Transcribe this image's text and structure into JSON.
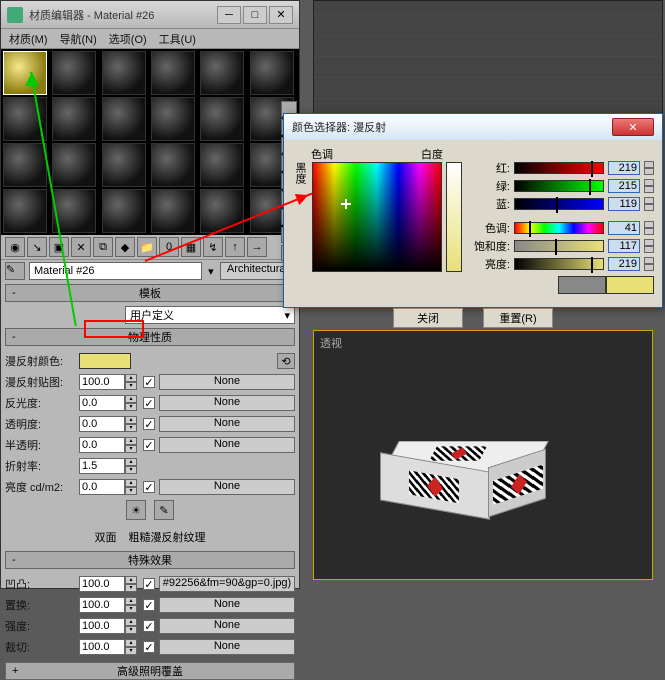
{
  "matEditor": {
    "title": "材质编辑器 - Material #26",
    "menu": [
      "材质(M)",
      "导航(N)",
      "选项(O)",
      "工具(U)"
    ],
    "materialName": "Material #26",
    "materialType": "Architectural"
  },
  "rollouts": {
    "template": {
      "title": "模板",
      "dropdown": "用户定义"
    },
    "physical": {
      "title": "物理性质",
      "diffuseColorLabel": "漫反射颜色:",
      "diffuseColor": "#e8e077",
      "rows": [
        {
          "label": "漫反射贴图:",
          "value": "100.0",
          "check": true,
          "map": "None"
        },
        {
          "label": "反光度:",
          "value": "0.0",
          "check": true,
          "map": "None"
        },
        {
          "label": "透明度:",
          "value": "0.0",
          "check": true,
          "map": "None"
        },
        {
          "label": "半透明:",
          "value": "0.0",
          "check": true,
          "map": "None"
        },
        {
          "label": "折射率:",
          "value": "1.5",
          "check": false,
          "map": ""
        },
        {
          "label": "亮度 cd/m2:",
          "value": "0.0",
          "check": true,
          "map": "None"
        }
      ],
      "twoSided": "双面",
      "roughDiffuse": "粗糙漫反射纹理"
    },
    "special": {
      "title": "特殊效果",
      "rows": [
        {
          "label": "凹凸:",
          "value": "100.0",
          "check": true,
          "map": "#92256&fm=90&gp=0.jpg)"
        },
        {
          "label": "置换:",
          "value": "100.0",
          "check": true,
          "map": "None"
        },
        {
          "label": "强度:",
          "value": "100.0",
          "check": true,
          "map": "None"
        },
        {
          "label": "裁切:",
          "value": "100.0",
          "check": true,
          "map": "None"
        }
      ]
    },
    "advanced": {
      "title": "高级照明覆盖"
    }
  },
  "colorPicker": {
    "title": "颜色选择器: 漫反射",
    "hueLabel": "色调",
    "whiteLabel": "白度",
    "blackLabel": "黑度",
    "channels": [
      {
        "name": "红:",
        "val": "219",
        "grad": "linear-gradient(to right,#000,#f00)"
      },
      {
        "name": "绿:",
        "val": "215",
        "grad": "linear-gradient(to right,#000,#0f0)"
      },
      {
        "name": "蓝:",
        "val": "119",
        "grad": "linear-gradient(to right,#000,#00f)"
      },
      {
        "name": "色调:",
        "val": "41",
        "grad": "linear-gradient(to right,#f00,#ff0,#0f0,#0ff,#00f,#f0f,#f00)"
      },
      {
        "name": "饱和度:",
        "val": "117",
        "grad": "linear-gradient(to right,#888,#e8e077)"
      },
      {
        "name": "亮度:",
        "val": "219",
        "grad": "linear-gradient(to right,#000,#e8e077)"
      }
    ],
    "closeBtn": "关闭",
    "resetBtn": "重置(R)"
  },
  "viewport": {
    "label": "透视"
  }
}
